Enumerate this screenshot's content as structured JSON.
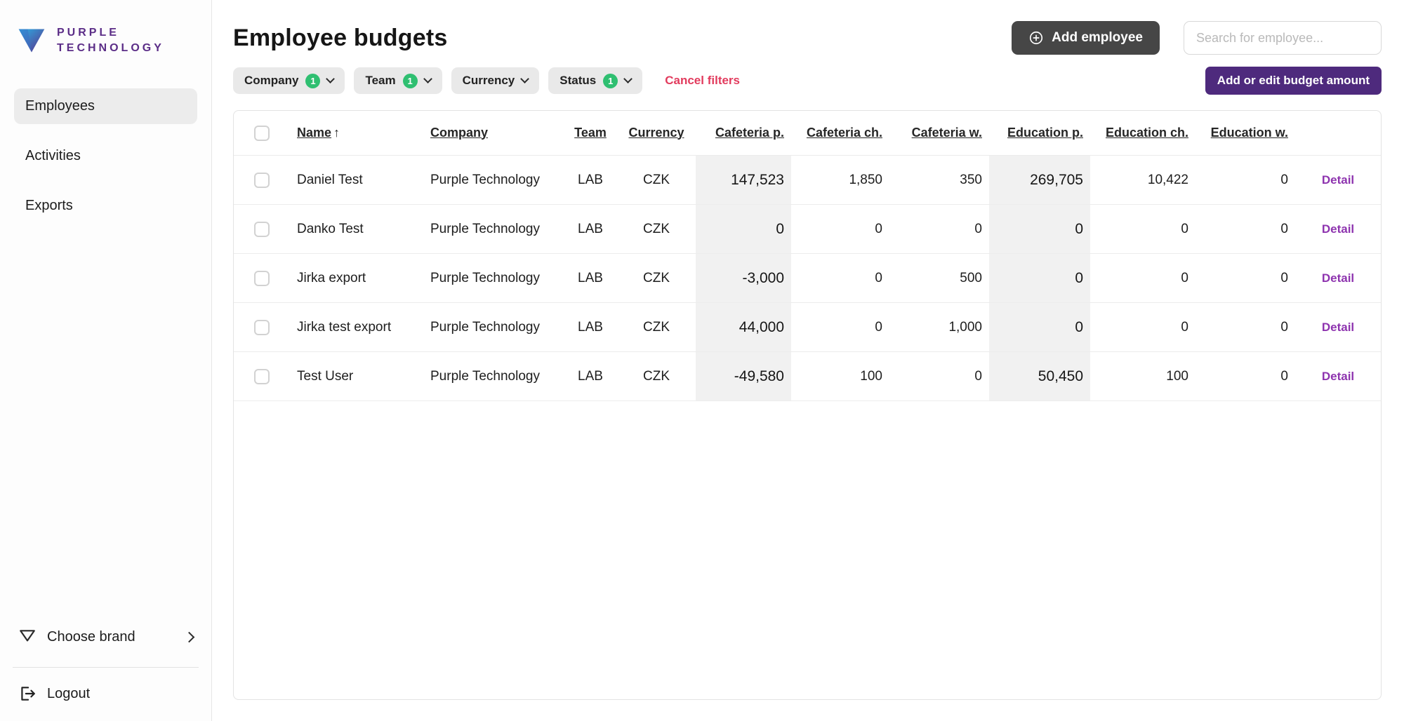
{
  "sidebar": {
    "brand": {
      "line1": "PURPLE",
      "line2": "TECHNOLOGY"
    },
    "items": [
      {
        "label": "Employees",
        "active": true
      },
      {
        "label": "Activities",
        "active": false
      },
      {
        "label": "Exports",
        "active": false
      }
    ],
    "choose_brand_label": "Choose brand",
    "logout_label": "Logout"
  },
  "header": {
    "title": "Employee budgets",
    "add_employee_label": "Add employee",
    "search_placeholder": "Search for employee..."
  },
  "filters": {
    "company": {
      "label": "Company",
      "count": "1"
    },
    "team": {
      "label": "Team",
      "count": "1"
    },
    "currency": {
      "label": "Currency"
    },
    "status": {
      "label": "Status",
      "count": "1"
    },
    "cancel_label": "Cancel filters",
    "budget_button_label": "Add or edit budget amount"
  },
  "table": {
    "columns": {
      "name": "Name",
      "company": "Company",
      "team": "Team",
      "currency": "Currency",
      "cafeteria_p": "Cafeteria p.",
      "cafeteria_ch": "Cafeteria ch.",
      "cafeteria_w": "Cafeteria w.",
      "education_p": "Education p.",
      "education_ch": "Education ch.",
      "education_w": "Education w."
    },
    "sort": {
      "column": "Name",
      "direction": "asc",
      "arrow": "↑"
    },
    "detail_label": "Detail",
    "rows": [
      {
        "name": "Daniel Test",
        "company": "Purple Technology",
        "team": "LAB",
        "currency": "CZK",
        "cafeteria_p": "147,523",
        "cafeteria_ch": "1,850",
        "cafeteria_w": "350",
        "education_p": "269,705",
        "education_ch": "10,422",
        "education_w": "0"
      },
      {
        "name": "Danko Test",
        "company": "Purple Technology",
        "team": "LAB",
        "currency": "CZK",
        "cafeteria_p": "0",
        "cafeteria_ch": "0",
        "cafeteria_w": "0",
        "education_p": "0",
        "education_ch": "0",
        "education_w": "0"
      },
      {
        "name": "Jirka export",
        "company": "Purple Technology",
        "team": "LAB",
        "currency": "CZK",
        "cafeteria_p": "-3,000",
        "cafeteria_ch": "0",
        "cafeteria_w": "500",
        "education_p": "0",
        "education_ch": "0",
        "education_w": "0"
      },
      {
        "name": "Jirka test export",
        "company": "Purple Technology",
        "team": "LAB",
        "currency": "CZK",
        "cafeteria_p": "44,000",
        "cafeteria_ch": "0",
        "cafeteria_w": "1,000",
        "education_p": "0",
        "education_ch": "0",
        "education_w": "0"
      },
      {
        "name": "Test User",
        "company": "Purple Technology",
        "team": "LAB",
        "currency": "CZK",
        "cafeteria_p": "-49,580",
        "cafeteria_ch": "100",
        "cafeteria_w": "0",
        "education_p": "50,450",
        "education_ch": "100",
        "education_w": "0"
      }
    ]
  },
  "colors": {
    "brand_purple": "#5b2d87",
    "button_dark": "#464646",
    "button_purple": "#4e2a7d",
    "badge_green": "#2fbf71",
    "cancel_red": "#e23b5d",
    "detail_link": "#8e34af",
    "highlight_column": "#f1f1f1"
  }
}
